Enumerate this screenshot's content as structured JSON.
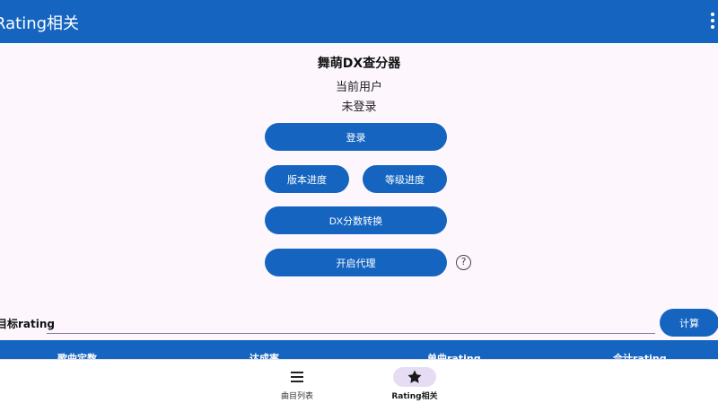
{
  "appbar": {
    "title": "Rating相关"
  },
  "main": {
    "heading": "舞萌DX查分器",
    "user_label": "当前用户",
    "user_status": "未登录",
    "buttons": {
      "login": "登录",
      "version_progress": "版本进度",
      "level_progress": "等级进度",
      "dx_convert": "DX分数转换",
      "proxy": "开启代理"
    },
    "help_icon": "?"
  },
  "target": {
    "label": "目标rating",
    "value": "",
    "calc_button": "计算"
  },
  "table": {
    "columns": [
      "歌曲定数",
      "达成率",
      "单曲rating",
      "合计rating"
    ]
  },
  "bottom_nav": {
    "items": [
      {
        "label": "曲目列表",
        "icon": "menu-icon"
      },
      {
        "label": "Rating相关",
        "icon": "star-icon",
        "selected": true
      }
    ]
  },
  "colors": {
    "primary": "#1565c0",
    "background": "#fdf7fd",
    "nav_indicator": "#e6dcf4"
  }
}
